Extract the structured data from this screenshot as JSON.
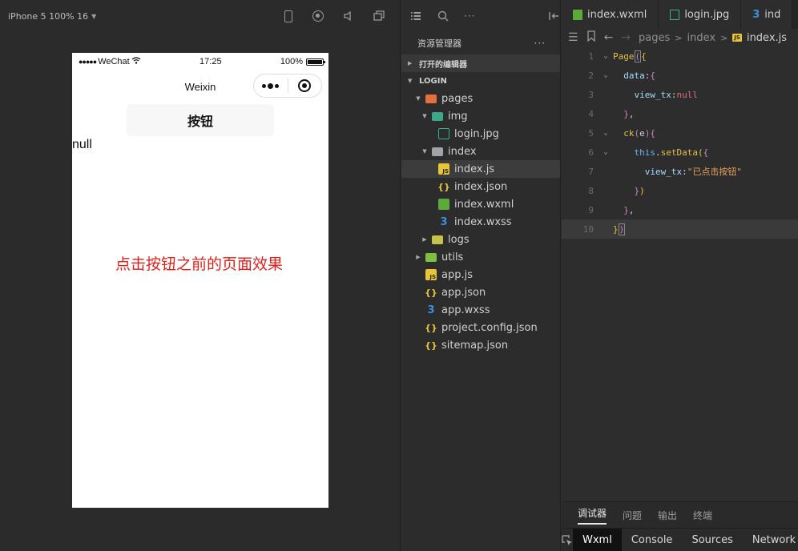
{
  "simulator": {
    "device_label": "iPhone 5 100% 16",
    "status": {
      "carrier": "WeChat",
      "time": "17:25",
      "battery": "100%"
    },
    "nav_title": "Weixin",
    "button_label": "按钮",
    "view_text": "null",
    "annotation": "点击按钮之前的页面效果",
    "annotation_color": "#e0201b"
  },
  "explorer": {
    "header": "资源管理器",
    "more": "···",
    "open_editors": "打开的编辑器",
    "project": "LOGIN",
    "tree": [
      {
        "label": "pages",
        "depth": 1,
        "type": "folder-open",
        "arrow": "▼"
      },
      {
        "label": "img",
        "depth": 2,
        "type": "folder-img",
        "arrow": "▼"
      },
      {
        "label": "login.jpg",
        "depth": 3,
        "type": "jpg",
        "arrow": ""
      },
      {
        "label": "index",
        "depth": 2,
        "type": "folder-plain",
        "arrow": "▼"
      },
      {
        "label": "index.js",
        "depth": 3,
        "type": "js",
        "arrow": "",
        "selected": true
      },
      {
        "label": "index.json",
        "depth": 3,
        "type": "json",
        "arrow": ""
      },
      {
        "label": "index.wxml",
        "depth": 3,
        "type": "wxml",
        "arrow": ""
      },
      {
        "label": "index.wxss",
        "depth": 3,
        "type": "wxss",
        "arrow": ""
      },
      {
        "label": "logs",
        "depth": 2,
        "type": "folder-logs",
        "arrow": "▶"
      },
      {
        "label": "utils",
        "depth": 1,
        "type": "folder-utils",
        "arrow": "▶"
      },
      {
        "label": "app.js",
        "depth": 1,
        "type": "js",
        "arrow": ""
      },
      {
        "label": "app.json",
        "depth": 1,
        "type": "json",
        "arrow": ""
      },
      {
        "label": "app.wxss",
        "depth": 1,
        "type": "wxss",
        "arrow": ""
      },
      {
        "label": "project.config.json",
        "depth": 1,
        "type": "json",
        "arrow": ""
      },
      {
        "label": "sitemap.json",
        "depth": 1,
        "type": "json",
        "arrow": ""
      }
    ]
  },
  "editor": {
    "tabs": [
      {
        "label": "index.wxml",
        "icon": "wxml"
      },
      {
        "label": "login.jpg",
        "icon": "jpg"
      },
      {
        "label": "ind",
        "icon": "wxss"
      }
    ],
    "breadcrumb": {
      "p1": "pages",
      "p2": "index",
      "file": "index.js"
    },
    "code": [
      {
        "n": "1",
        "fold": "⌄"
      },
      {
        "n": "2",
        "fold": "⌄"
      },
      {
        "n": "3",
        "fold": ""
      },
      {
        "n": "4",
        "fold": ""
      },
      {
        "n": "5",
        "fold": "⌄"
      },
      {
        "n": "6",
        "fold": "⌄"
      },
      {
        "n": "7",
        "fold": ""
      },
      {
        "n": "8",
        "fold": ""
      },
      {
        "n": "9",
        "fold": ""
      },
      {
        "n": "10",
        "fold": ""
      }
    ],
    "code_tokens": {
      "page": "Page",
      "data": "data",
      "view_tx": "view_tx",
      "null": "null",
      "ck": "ck",
      "e": "e",
      "this": "this",
      "setData": "setData",
      "str": "\"已点击按钮\""
    },
    "devtools_tabs": [
      "调试器",
      "问题",
      "输出",
      "终端"
    ],
    "panel_tabs": [
      "Wxml",
      "Console",
      "Sources",
      "Network"
    ]
  }
}
